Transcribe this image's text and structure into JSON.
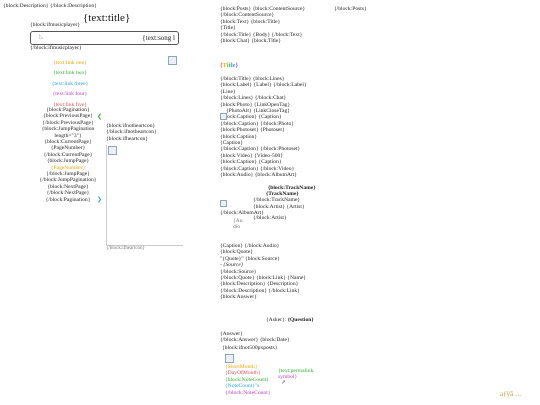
{
  "left": {
    "description_line": "{block:Description} {/block:Description}",
    "title_tag": "{text:title}",
    "music_open": "{block:ifmusicplayer}",
    "song_text": "{text:song l",
    "music_close": "{/block:ifmusicplayer}",
    "links": [
      "{text:link one}",
      "{text:link two}",
      "{text:link three}",
      "{text:link four}",
      "{text:link five}"
    ],
    "pagination": [
      "{block:Pagination}",
      "{block:PreviousPage}",
      "{/block:PreviousPage}",
      "{block:JumpPagination",
      "length=\"3\"}",
      "{block:CurrentPage}",
      "{PageNumber}",
      "{/block:CurrentPage}",
      "{block:JumpPage}",
      "{PageNumber}",
      "{/block:JumpPage}",
      "{/block:JumpPagination}",
      "{block:NextPage}",
      "{/block:NextPage}",
      "{/block:Pagination}"
    ],
    "side_tags": [
      "{block:ifnotheartcon}",
      "{/block:ifnotheartcon}",
      "{block:ifheartcon}"
    ],
    "bottom_frag": "{/block:ifheartcon}"
  },
  "mid": {
    "top": [
      "{block:Posts}  {block:ContentSource}",
      "{/block:ContentSource}",
      "{block:Text}  {block:Title}",
      "{Title}",
      "{/block:Title}  {Body}  {/block:Text}",
      "{block:Chat}  {block:Title}"
    ],
    "posts_close": "{/block:Posts}",
    "title_colored": "{Title}",
    "chat_block": [
      "{/block:Title}  {block:Lines}",
      "{block:Label}  {Label}  {/block:Label}",
      "{Line}",
      "{/block:Lines}  {/block:Chat}",
      "{block:Photo}  {LinkOpenTag}",
      "{PhotoAlt}  {LinkCloseTag}",
      "{block:Caption}  {Caption}",
      "{/block:Caption}  {/block:Photo}",
      "{block:Photoset}  {Photoset}",
      "{block:Caption}",
      "{Caption}",
      "{/block:Caption}  {/block:Photoset}",
      "{block:Video}  {Video-500}",
      "{block:Caption}  {Caption}",
      "{/block:Caption}  {/block:Video}",
      "{block:Audio}  {block:AlbumArt}"
    ],
    "overlap_tags": [
      "{block:TrackName}",
      "{TrackName}",
      "{block:Artist}",
      "{Artist}"
    ],
    "album_tags": [
      "{/block:AlbumArt}",
      "{/block:TrackName}",
      "{block:Artist}  {Artist}",
      "{/block:Artist}"
    ],
    "audio_faint": [
      "{Au",
      "dio"
    ],
    "quote_block": [
      "{Caption}  {/block:Audio}",
      "{block:Quote}",
      "\"{Quote}\"  {block:Source}",
      "- {Source}",
      "{/block:Source}",
      "{/block:Quote}  {block:Link}  {Name}",
      "{block:Description}  {Description}",
      "{/block:Description}  {/block:Link}",
      "{block:Answer}"
    ],
    "asker_line": "{Asker}:",
    "question": "{Question}",
    "answer_block": [
      "{Answer}",
      "{/block:Answer}  {block:Date}",
      "{block:ifnot500pxposts}"
    ],
    "date_tags": [
      "{ShortMonth}",
      "{DayOfMonth}",
      "{block:NoteCount}",
      "{NoteCount}\"s",
      "{/block:NoteCount}"
    ],
    "permalink": [
      "{text:permalink",
      "symbol}"
    ],
    "corner_mark": "aƒÿã …"
  }
}
